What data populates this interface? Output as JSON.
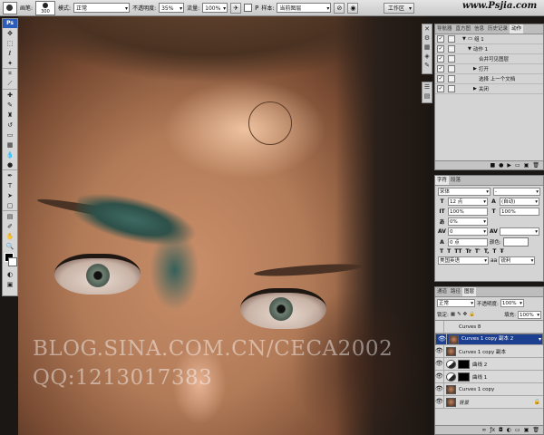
{
  "top_watermark": "www.Psjia.com",
  "options_bar": {
    "brush_label": "画笔:",
    "brush_size": "300",
    "mode_label": "模式:",
    "mode_value": "正常",
    "opacity_label": "不透明度:",
    "opacity_value": "35%",
    "flow_label": "流量:",
    "flow_value": "100%",
    "sample_label": "样本:",
    "sample_value": "当前图层",
    "workspace_label": "工作区"
  },
  "actions_panel": {
    "tabs": [
      "导航器",
      "直方图",
      "信息",
      "历史记录",
      "动作"
    ],
    "active_tab": 4,
    "items": [
      {
        "label": "组 1",
        "indent": 1,
        "arrow": "▼",
        "kind": "folder"
      },
      {
        "label": "动作 1",
        "indent": 2,
        "arrow": "▼",
        "kind": "action"
      },
      {
        "label": "合并可见图层",
        "indent": 4,
        "arrow": "",
        "kind": "step"
      },
      {
        "label": "打开",
        "indent": 3,
        "arrow": "▶",
        "kind": "step"
      },
      {
        "label": "选择 上一个文档",
        "indent": 4,
        "arrow": "",
        "kind": "step"
      },
      {
        "label": "关闭",
        "indent": 3,
        "arrow": "▶",
        "kind": "step"
      }
    ]
  },
  "character_panel": {
    "tabs": [
      "字符",
      "段落"
    ],
    "active_tab": 0,
    "font_family": "宋体",
    "font_style": "-",
    "font_size": "12 点",
    "leading": "(自动)",
    "vertical_scale": "100%",
    "horizontal_scale": "100%",
    "tracking_percent": "0%",
    "tracking": "0",
    "kerning": "",
    "baseline_shift": "0 点",
    "color_label": "颜色:",
    "style_buttons": [
      "T",
      "T",
      "TT",
      "Tr",
      "T'",
      "T,",
      "T",
      "Ŧ"
    ],
    "language": "美国英语",
    "aa_label": "aa",
    "antialias": "锐利"
  },
  "layers_panel": {
    "tabs": [
      "通道",
      "路径",
      "图层"
    ],
    "active_tab": 2,
    "blend_mode": "正常",
    "opacity_label": "不透明度:",
    "opacity_value": "100%",
    "lock_label": "锁定:",
    "fill_label": "填充:",
    "fill_value": "100%",
    "layers": [
      {
        "name": "Curves 8",
        "visible": false,
        "thumb": "none",
        "selected": false
      },
      {
        "name": "Curves 1 copy 副本 2",
        "visible": true,
        "thumb": "photo",
        "selected": true
      },
      {
        "name": "Curves 1 copy 副本",
        "visible": true,
        "thumb": "photo",
        "selected": false
      },
      {
        "name": "曲线 2",
        "visible": true,
        "thumb": "adj-mask",
        "selected": false
      },
      {
        "name": "曲线 1",
        "visible": true,
        "thumb": "adj-mask",
        "selected": false
      },
      {
        "name": "Curves 1 copy",
        "visible": true,
        "thumb": "photo",
        "selected": false
      },
      {
        "name": "背景",
        "visible": true,
        "thumb": "photo",
        "selected": false,
        "locked": true
      }
    ]
  },
  "canvas_watermark": {
    "line1": "BLOG.SINA.COM.CN/CECA2002",
    "line2": "QQ:1213017383"
  },
  "colors": {
    "selected_layer": "#1d3f8f",
    "panel_bg": "#d4d4d4",
    "eye_shadow_green": "#35605a"
  }
}
